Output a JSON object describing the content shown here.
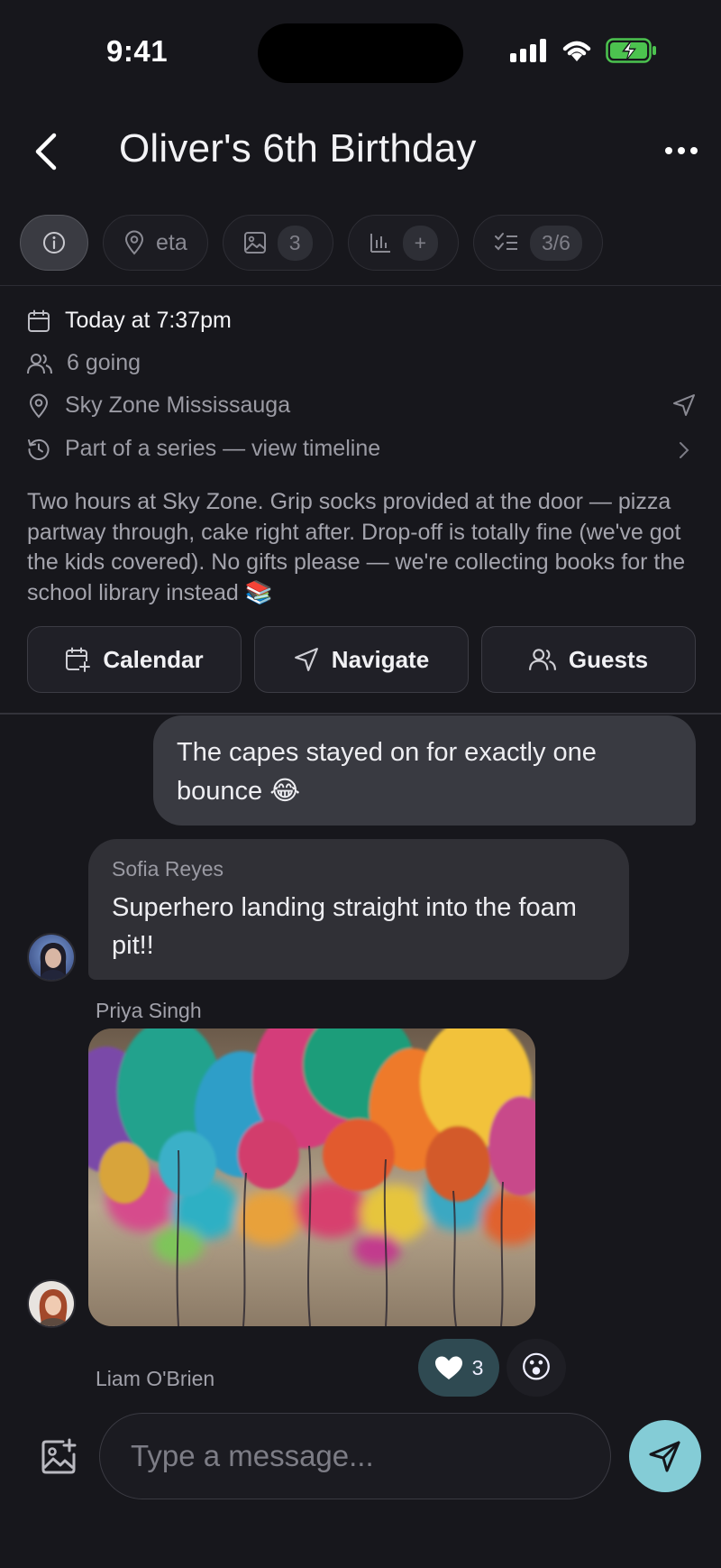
{
  "status_bar": {
    "time": "9:41"
  },
  "header": {
    "title": "Oliver's 6th Birthday"
  },
  "tabs": [
    {
      "icon": "info-icon",
      "label": "",
      "active": true
    },
    {
      "icon": "location-pin-icon",
      "label": "eta"
    },
    {
      "icon": "image-icon",
      "count": "3"
    },
    {
      "icon": "bar-chart-icon",
      "count": "+"
    },
    {
      "icon": "checklist-icon",
      "count": "3/6"
    }
  ],
  "details": {
    "datetime": "Today at 7:37pm",
    "going": "6 going",
    "location": "Sky Zone Mississauga",
    "series": "Part of a series — view timeline"
  },
  "description": "Two hours at Sky Zone. Grip socks provided at the door — pizza partway through, cake right after. Drop-off is totally fine (we've got the kids covered). No gifts please — we're collecting books for the school library instead 📚",
  "actions": {
    "calendar": "Calendar",
    "navigate": "Navigate",
    "guests": "Guests"
  },
  "messages": {
    "outgoing_1": "The capes stayed on for exactly one bounce 😂",
    "sofia_name": "Sofia Reyes",
    "sofia_text": "Superhero landing straight into the foam pit!!",
    "priya_name": "Priya Singh",
    "liam_name": "Liam O'Brien"
  },
  "reactions": {
    "heart_count": "3",
    "wow_emoji": "😮"
  },
  "composer": {
    "placeholder": "Type a message..."
  },
  "colors": {
    "accent": "#84ccd6",
    "background": "#17171c",
    "bubble_out": "#393a41",
    "bubble_in": "#303036"
  }
}
